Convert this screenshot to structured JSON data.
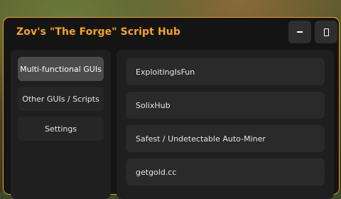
{
  "window": {
    "title": "Zov's \"The Forge\" Script Hub",
    "minimize_icon": "minus-icon",
    "maximize_icon": "maximize-icon",
    "accent_color": "#f39b19"
  },
  "sidebar": {
    "items": [
      {
        "label": "Multi-functional GUIs",
        "active": true
      },
      {
        "label": "Other GUIs / Scripts",
        "active": false
      },
      {
        "label": "Settings",
        "active": false
      }
    ]
  },
  "main": {
    "scripts": [
      {
        "label": "ExploitingIsFun"
      },
      {
        "label": "SolixHub"
      },
      {
        "label": "Safest / Undetectable Auto-Miner"
      },
      {
        "label": "getgold.cc"
      }
    ]
  }
}
